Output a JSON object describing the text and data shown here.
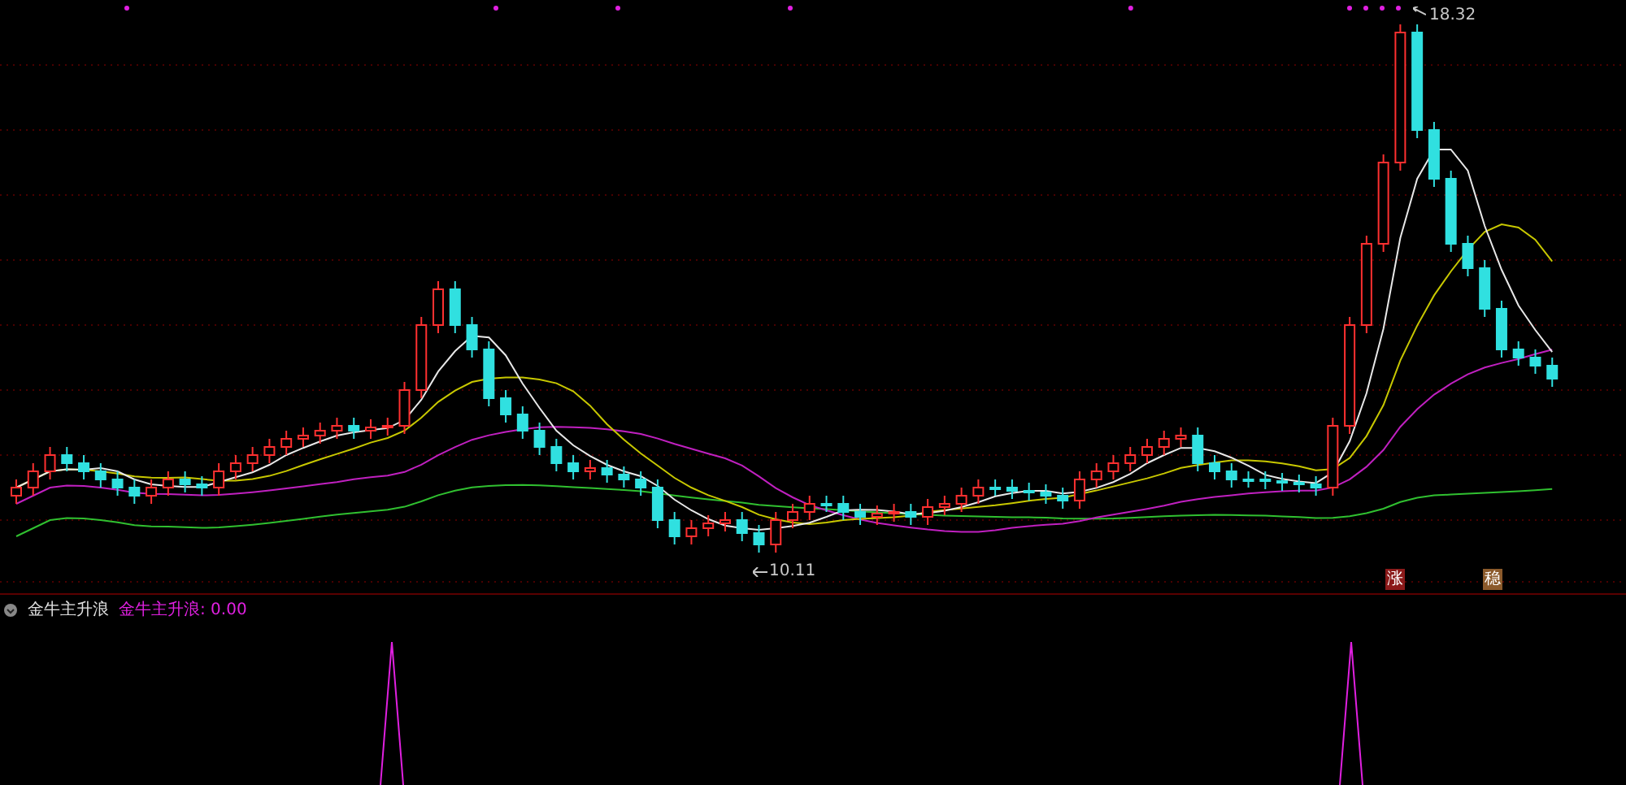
{
  "main_chart": {
    "high_label": "18.32",
    "low_label": "10.11",
    "signal_badges": [
      {
        "text": "涨",
        "color": "#8b1a1a"
      },
      {
        "text": "稳",
        "color": "#8b5a2b"
      }
    ]
  },
  "indicator": {
    "name": "金牛主升浪",
    "legend": "金牛主升浪: 0.00"
  }
}
